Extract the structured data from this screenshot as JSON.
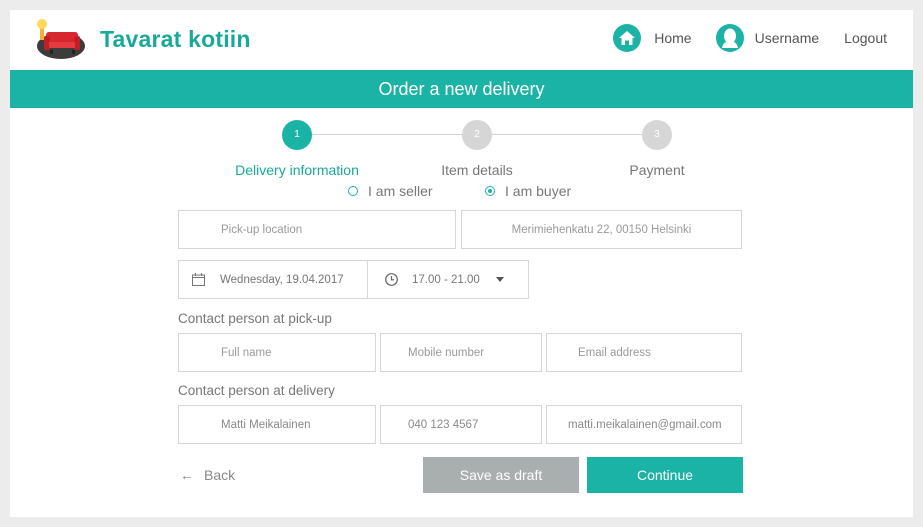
{
  "header": {
    "brand_name": "Tavarat kotiin",
    "nav": {
      "home": "Home",
      "username": "Username",
      "logout": "Logout"
    }
  },
  "banner": {
    "title": "Order a new delivery"
  },
  "stepper": {
    "steps": [
      {
        "number": "1",
        "label": "Delivery information",
        "active": true
      },
      {
        "number": "2",
        "label": "Item details",
        "active": false
      },
      {
        "number": "3",
        "label": "Payment",
        "active": false
      }
    ]
  },
  "role": {
    "options": [
      {
        "label": "I am seller",
        "checked": false
      },
      {
        "label": "I am buyer",
        "checked": true
      }
    ]
  },
  "locations": {
    "pickup_placeholder": "Pick-up location",
    "delivery_value": "Merimiehenkatu 22, 00150 Helsinki"
  },
  "schedule": {
    "date": "Wednesday, 19.04.2017",
    "time": "17.00 - 21.00"
  },
  "pickup_contact": {
    "heading": "Contact person at pick-up",
    "full_name_placeholder": "Full name",
    "mobile_placeholder": "Mobile number",
    "email_placeholder": "Email address"
  },
  "delivery_contact": {
    "heading": "Contact person at delivery",
    "full_name": "Matti Meikalainen",
    "mobile": "040 123 4567",
    "email": "matti.meikalainen@gmail.com"
  },
  "actions": {
    "back": "Back",
    "save_draft": "Save as draft",
    "continue": "Continue"
  },
  "colors": {
    "accent": "#1bb3a5",
    "button_gray": "#a9aeaf",
    "page_bg": "#ececec"
  }
}
